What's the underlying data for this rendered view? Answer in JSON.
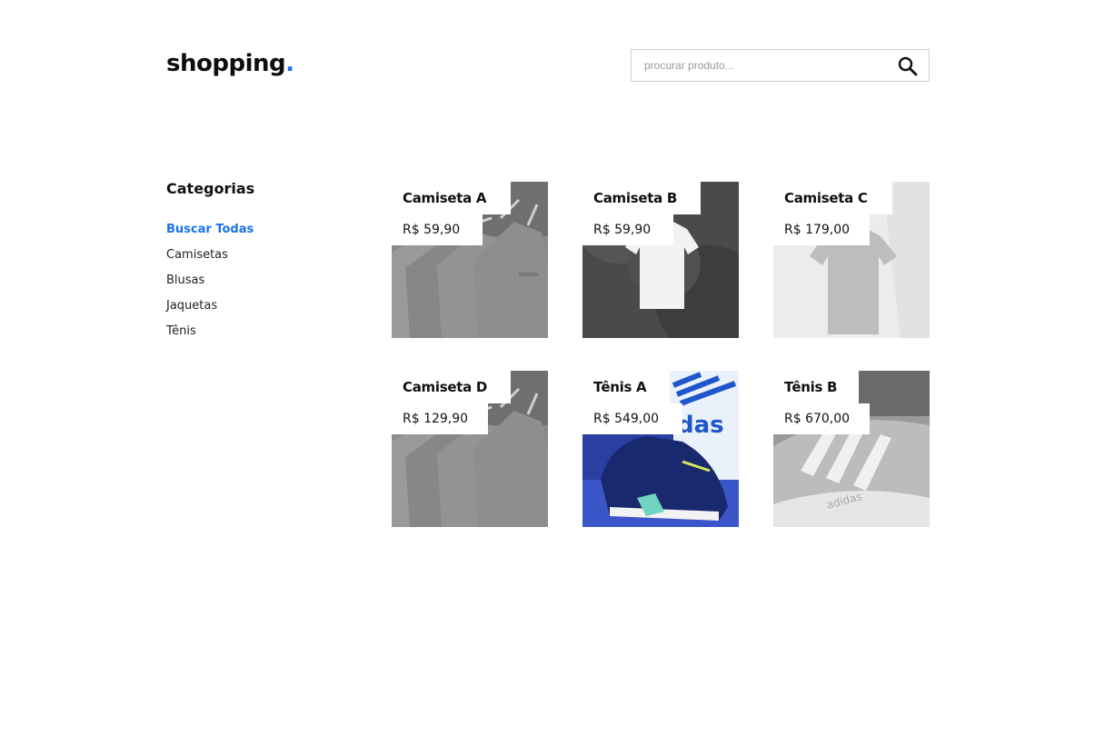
{
  "header": {
    "logo_text": "shopping",
    "logo_dot": ".",
    "search_placeholder": "procurar produto..."
  },
  "sidebar": {
    "title": "Categorias",
    "items": [
      {
        "label": "Buscar Todas",
        "active": true
      },
      {
        "label": "Camisetas"
      },
      {
        "label": "Blusas"
      },
      {
        "label": "Jaquetas"
      },
      {
        "label": "Tênis"
      }
    ]
  },
  "products": [
    {
      "name": "Camiseta A",
      "price": "R$ 59,90",
      "image": "grey-shirts-on-hangers"
    },
    {
      "name": "Camiseta B",
      "price": "R$ 59,90",
      "image": "white-shirt-on-wall"
    },
    {
      "name": "Camiseta C",
      "price": "R$ 179,00",
      "image": "grey-shirt-hanging"
    },
    {
      "name": "Camiseta D",
      "price": "R$ 129,90",
      "image": "grey-shirts-on-hangers"
    },
    {
      "name": "Tênis A",
      "price": "R$ 549,00",
      "image": "blue-sneaker-display"
    },
    {
      "name": "Tênis B",
      "price": "R$ 670,00",
      "image": "grey-sneaker-closeup"
    }
  ],
  "colors": {
    "accent": "#1a73e8",
    "text": "#111111",
    "border": "#cfcfcf"
  },
  "icons": {
    "search": "search-icon"
  }
}
